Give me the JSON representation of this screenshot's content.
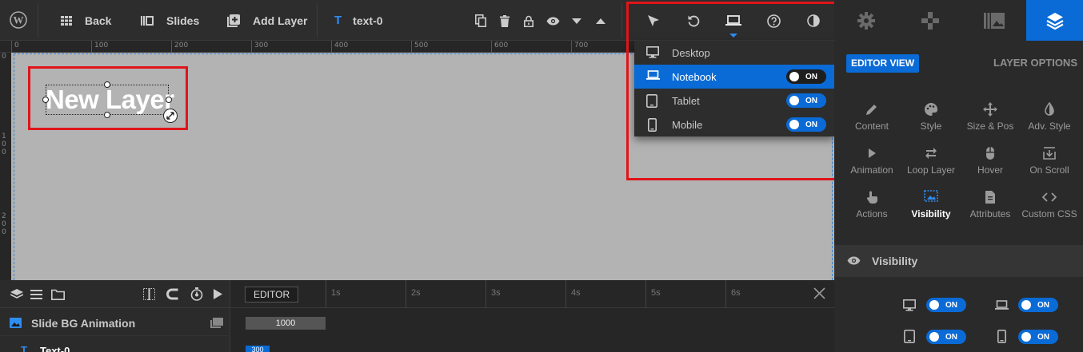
{
  "toolbar": {
    "back_label": "Back",
    "slides_label": "Slides",
    "add_layer_label": "Add Layer",
    "layer_name": "text-0"
  },
  "ruler": {
    "top_ticks": [
      "0",
      "100",
      "200",
      "300",
      "400",
      "500",
      "600",
      "700"
    ],
    "left_ticks": [
      "0",
      "1\n0\n0",
      "2\n0\n0"
    ]
  },
  "canvas": {
    "layer_text": "New Layer"
  },
  "device_menu": {
    "items": [
      {
        "label": "Desktop",
        "icon": "desktop-icon",
        "toggle": null,
        "active": false
      },
      {
        "label": "Notebook",
        "icon": "notebook-icon",
        "toggle": "ON",
        "active": true
      },
      {
        "label": "Tablet",
        "icon": "tablet-icon",
        "toggle": "ON",
        "active": false
      },
      {
        "label": "Mobile",
        "icon": "mobile-icon",
        "toggle": "ON",
        "active": false
      }
    ]
  },
  "right_panel": {
    "editor_view_label": "EDITOR VIEW",
    "layer_options_label": "LAYER OPTIONS",
    "options": [
      {
        "label": "Content",
        "icon": "pencil-icon"
      },
      {
        "label": "Style",
        "icon": "palette-icon"
      },
      {
        "label": "Size & Pos",
        "icon": "move-icon"
      },
      {
        "label": "Adv. Style",
        "icon": "contrast-icon"
      },
      {
        "label": "Animation",
        "icon": "play-icon"
      },
      {
        "label": "Loop Layer",
        "icon": "loop-icon"
      },
      {
        "label": "Hover",
        "icon": "mouse-icon"
      },
      {
        "label": "On Scroll",
        "icon": "scroll-icon"
      },
      {
        "label": "Actions",
        "icon": "hand-pointer-icon"
      },
      {
        "label": "Visibility",
        "icon": "visibility-icon",
        "active": true
      },
      {
        "label": "Attributes",
        "icon": "document-icon"
      },
      {
        "label": "Custom CSS",
        "icon": "code-icon"
      }
    ],
    "section_title": "Visibility",
    "vis_toggles": [
      "ON",
      "ON",
      "ON",
      "ON"
    ]
  },
  "timeline": {
    "editor_label": "EDITOR",
    "time_marks": [
      "1s",
      "2s",
      "3s",
      "4s",
      "5s",
      "6s"
    ],
    "rows": [
      {
        "label": "Slide BG Animation",
        "bar_value": "1000"
      },
      {
        "label": "Text-0",
        "bar_value": "300"
      }
    ]
  },
  "colors": {
    "accent": "#0a6bd6",
    "highlight_border": "#e0141a",
    "canvas_bg": "#b3b3b3"
  }
}
